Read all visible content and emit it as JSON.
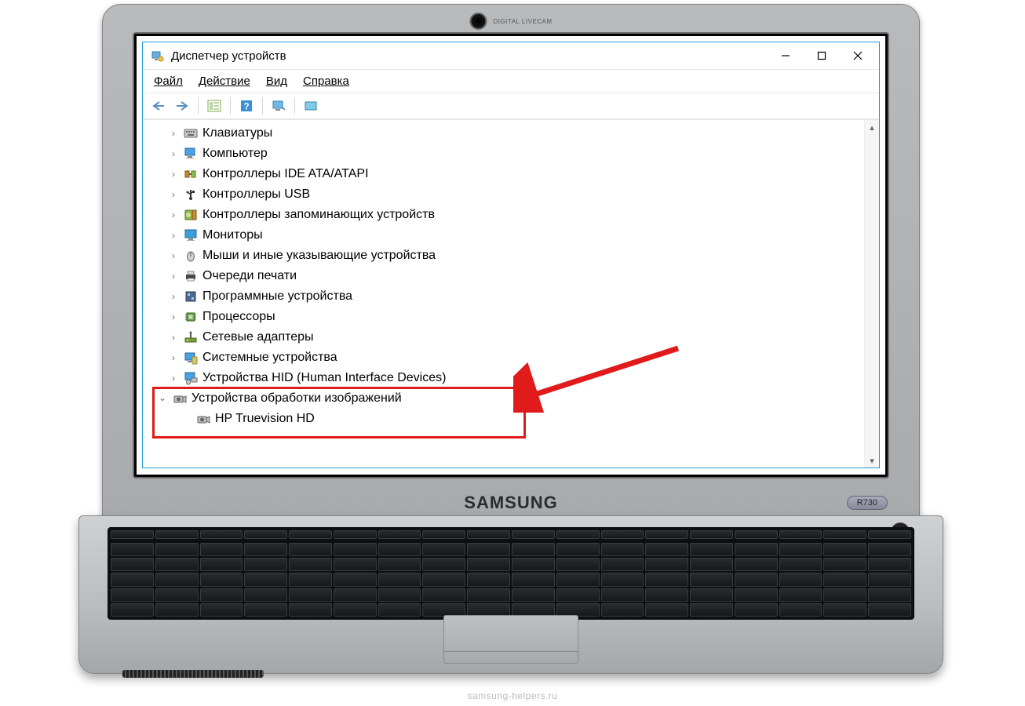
{
  "window": {
    "title": "Диспетчер устройств"
  },
  "menu": {
    "file": "Файл",
    "action": "Действие",
    "view": "Вид",
    "help": "Справка"
  },
  "tree": {
    "items": [
      {
        "label": "Клавиатуры",
        "icon": "keyboard"
      },
      {
        "label": "Компьютер",
        "icon": "computer"
      },
      {
        "label": "Контроллеры IDE ATA/ATAPI",
        "icon": "ide"
      },
      {
        "label": "Контроллеры USB",
        "icon": "usb"
      },
      {
        "label": "Контроллеры запоминающих устройств",
        "icon": "storage"
      },
      {
        "label": "Мониторы",
        "icon": "monitor"
      },
      {
        "label": "Мыши и иные указывающие устройства",
        "icon": "mouse"
      },
      {
        "label": "Очереди печати",
        "icon": "printer"
      },
      {
        "label": "Программные устройства",
        "icon": "software"
      },
      {
        "label": "Процессоры",
        "icon": "cpu"
      },
      {
        "label": "Сетевые адаптеры",
        "icon": "network"
      },
      {
        "label": "Системные устройства",
        "icon": "system"
      },
      {
        "label": "Устройства HID (Human Interface Devices)",
        "icon": "hid"
      }
    ],
    "expanded": {
      "label": "Устройства обработки изображений",
      "icon": "camera",
      "children": [
        {
          "label": "HP Truevision HD",
          "icon": "camera"
        }
      ]
    }
  },
  "laptop": {
    "brand": "SAMSUNG",
    "model": "R730",
    "webcam": "DIGITAL LIVECAM"
  },
  "watermark": "samsung-helpers.ru"
}
